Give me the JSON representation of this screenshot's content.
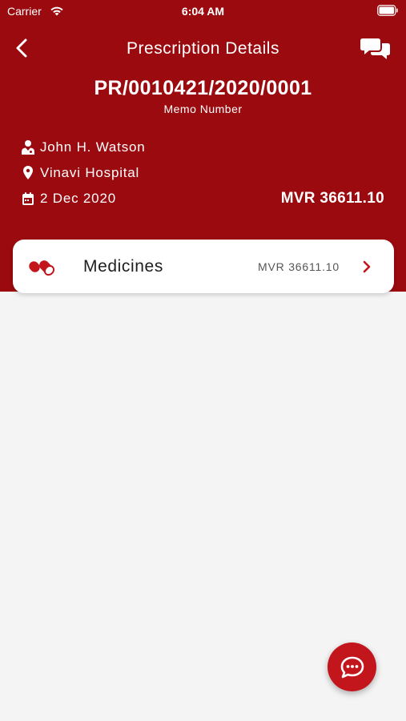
{
  "status_bar": {
    "carrier": "Carrier",
    "time": "6:04 AM"
  },
  "header": {
    "title": "Prescription Details",
    "memo_number": "PR/0010421/2020/0001",
    "memo_label": "Memo Number",
    "doctor": "John H. Watson",
    "hospital": "Vinavi Hospital",
    "date": "2 Dec 2020",
    "amount": "MVR 36611.10"
  },
  "card": {
    "label": "Medicines",
    "amount": "MVR 36611.10"
  },
  "icons": {
    "back": "chevron-left-icon",
    "chat": "chat-bubbles-icon",
    "doctor": "doctor-icon",
    "location": "location-pin-icon",
    "calendar": "calendar-icon",
    "medicine": "pill-icon",
    "chevron": "chevron-right-icon",
    "fab": "message-icon"
  },
  "colors": {
    "brand": "#9b0a0e",
    "fab": "#c3161c",
    "background": "#f4f4f4"
  }
}
